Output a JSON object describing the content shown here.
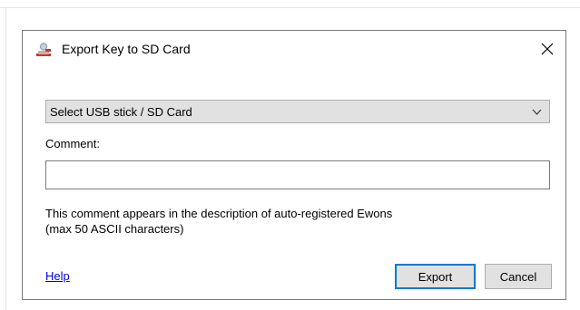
{
  "dialog": {
    "title": "Export Key to SD Card",
    "app_icon": "user-key-icon",
    "close_icon": "close-icon"
  },
  "device_select": {
    "selected": "Select USB stick / SD Card",
    "chevron_icon": "chevron-down-icon"
  },
  "comment": {
    "label": "Comment:",
    "value": "",
    "hint_line1": "This comment appears in the description of auto-registered Ewons",
    "hint_line2": "(max 50 ASCII characters)"
  },
  "footer": {
    "help_label": "Help",
    "export_label": "Export",
    "cancel_label": "Cancel"
  },
  "colors": {
    "focus_border": "#0078d7",
    "button_face": "#e1e1e1",
    "link": "#0000ee"
  }
}
